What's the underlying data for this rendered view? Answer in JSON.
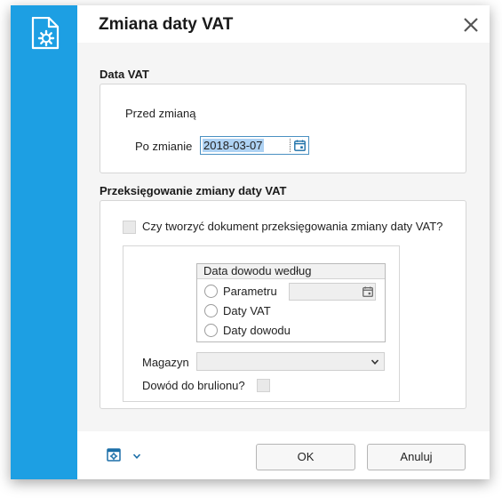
{
  "dialog": {
    "title": "Zmiana daty VAT",
    "close_icon": "close-icon",
    "side_icon": "document-settings-icon"
  },
  "vat_section": {
    "label": "Data VAT",
    "before_label": "Przed zmianą",
    "after_label": "Po zmianie",
    "after_value": "2018-03-07",
    "calendar_icon": "calendar-icon"
  },
  "rebook_section": {
    "label": "Przeksięgowanie zmiany daty VAT",
    "create_doc_label": "Czy tworzyć dokument przeksięgowania zmiany daty VAT?",
    "create_doc_checked": false,
    "group_title": "Data dowodu według",
    "options": [
      "Parametru",
      "Daty VAT",
      "Daty dowodu"
    ],
    "warehouse_label": "Magazyn",
    "warehouse_value": "",
    "draft_label": "Dowód do brulionu?",
    "draft_checked": false
  },
  "footer": {
    "settings_icon": "calendar-settings-icon",
    "menu_icon": "chevron-down-icon",
    "ok_label": "OK",
    "cancel_label": "Anuluj"
  },
  "colors": {
    "accent": "#1d9fe3",
    "selection": "#aed2f3",
    "icon_blue": "#1b6fa8"
  }
}
